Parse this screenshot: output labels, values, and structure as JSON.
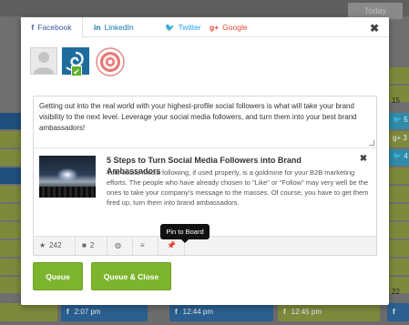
{
  "background": {
    "today_label": "Today",
    "day_numbers": [
      "15",
      "22"
    ],
    "bottom_items": [
      {
        "icon": "f",
        "time": "2:07 pm"
      },
      {
        "icon": "f",
        "time": "12:44 pm"
      },
      {
        "icon": "f",
        "time": "12:45 pm"
      }
    ],
    "right_items": [
      "5",
      "3",
      "4"
    ]
  },
  "modal": {
    "tabs": [
      {
        "icon": "f",
        "label": "Facebook"
      },
      {
        "icon": "in",
        "label": "LinkedIn"
      },
      {
        "icon": "🐦",
        "label": "Twitter"
      },
      {
        "icon": "g+",
        "label": "Google"
      }
    ],
    "close_symbol": "✖",
    "profile_check_symbol": "✔",
    "compose_text": "Getting out into the real world with your highest-profile social followers is what will take your brand visibility to the next level. Leverage your social media followers, and turn them into your best brand ambassadors!",
    "preview": {
      "title": "5 Steps to Turn Social Media Followers into Brand Ambassadors",
      "description": "Your social media following, if used properly, is a goldmine for your B2B marketing efforts. The people who have already chosen to \"Like\" or \"Follow\" may very well be the ones to take your company's message to the masses. Of course, you have to get them fired up, turn them into brand ambassadors.",
      "close_symbol": "✖"
    },
    "stats": {
      "shares": "242",
      "comments": "2",
      "star_symbol": "★",
      "comment_symbol": "■",
      "globe_symbol": "◍",
      "stack_symbol": "≡",
      "pin_symbol": "📌"
    },
    "tooltip": "Pin to Board",
    "buttons": {
      "queue": "Queue",
      "queue_close": "Queue & Close"
    }
  },
  "colors": {
    "accent_green": "#7db42d",
    "facebook_blue": "#3b5998",
    "linkedin_blue": "#0e76a8",
    "twitter_blue": "#1da1f2",
    "google_red": "#dd4b39"
  }
}
